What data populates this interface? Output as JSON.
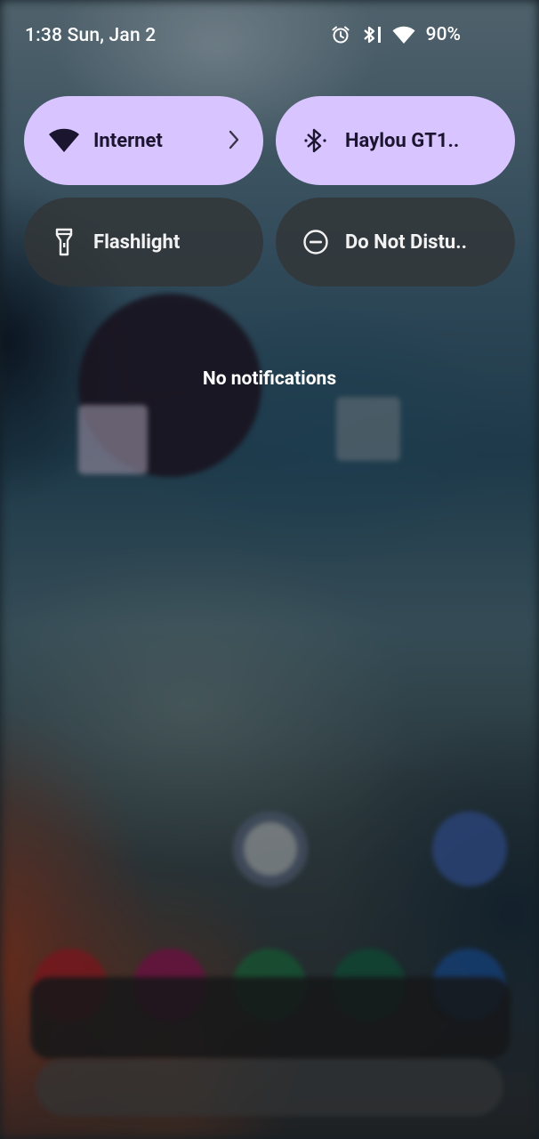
{
  "status_bar": {
    "time_date": "1:38 Sun, Jan 2",
    "battery": "90%"
  },
  "quick_settings": {
    "tiles": [
      {
        "label": "Internet",
        "state": "on"
      },
      {
        "label": "Haylou GT1..",
        "state": "on"
      },
      {
        "label": "Flashlight",
        "state": "off"
      },
      {
        "label": "Do Not Distu..",
        "state": "off"
      }
    ]
  },
  "notifications": {
    "empty_text": "No notifications"
  },
  "colors": {
    "tile_active": "#d8c5ff",
    "tile_inactive": "#323436",
    "text_on_dark": "#ffffff"
  }
}
